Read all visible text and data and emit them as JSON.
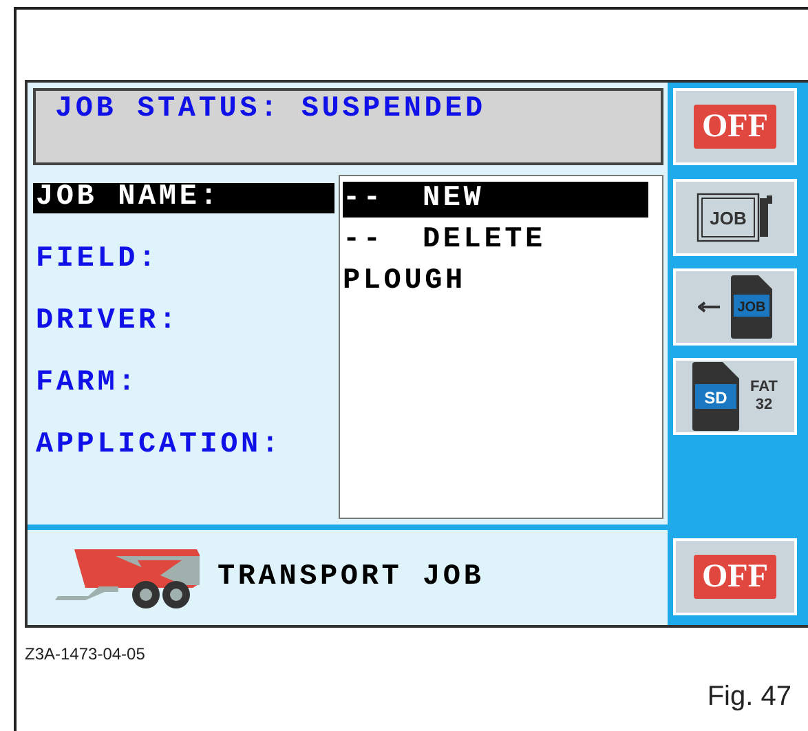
{
  "status": {
    "title": "JOB STATUS: SUSPENDED"
  },
  "fields": [
    {
      "label": "JOB NAME:",
      "selected": true
    },
    {
      "label": "FIELD:",
      "selected": false
    },
    {
      "label": "DRIVER:",
      "selected": false
    },
    {
      "label": "FARM:",
      "selected": false
    },
    {
      "label": "APPLICATION:",
      "selected": false
    }
  ],
  "options": [
    {
      "prefix": "--",
      "text": "NEW",
      "selected": true
    },
    {
      "prefix": "--",
      "text": "DELETE",
      "selected": false
    },
    {
      "text": "PLOUGH",
      "selected": false
    }
  ],
  "side_buttons": [
    {
      "kind": "off",
      "label": "OFF"
    },
    {
      "kind": "job_card",
      "label": "JOB"
    },
    {
      "kind": "import",
      "label": "JOB"
    },
    {
      "kind": "sd",
      "label": "SD",
      "lines": [
        "FAT",
        "32"
      ]
    }
  ],
  "bottom_bar": {
    "label": "TRANSPORT JOB",
    "button": {
      "kind": "off",
      "label": "OFF"
    }
  },
  "figure": {
    "code": "Z3A-1473-04-05",
    "caption": "Fig. 47"
  }
}
